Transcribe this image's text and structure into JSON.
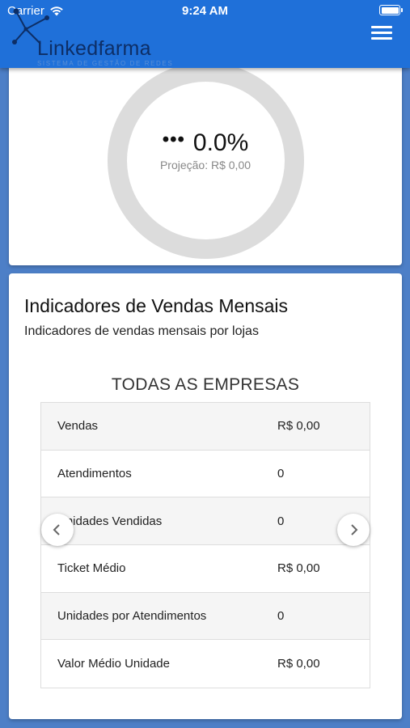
{
  "status_bar": {
    "carrier": "Carrier",
    "time": "9:24 AM"
  },
  "header": {
    "logo_text": "Linkedfarma",
    "logo_subtitle": "SISTEMA DE GESTÃO DE REDES",
    "menu_icon": "hamburger-menu-icon",
    "background_color": "#1f70d9"
  },
  "gauge": {
    "prefix": "•••",
    "value": "0.0%",
    "projection": "Projeção: R$ 0,00",
    "ring_color": "#dcdcdc"
  },
  "sales": {
    "title": "Indicadores de Vendas Mensais",
    "subtitle": "Indicadores de vendas mensais por lojas",
    "company": "TODAS AS EMPRESAS",
    "rows": [
      {
        "label": "Vendas",
        "value": "R$ 0,00"
      },
      {
        "label": "Atendimentos",
        "value": "0"
      },
      {
        "label": "Unidades Vendidas",
        "value": "0"
      },
      {
        "label": "Ticket Médio",
        "value": "R$ 0,00"
      },
      {
        "label": "Unidades por Atendimentos",
        "value": "0"
      },
      {
        "label": "Valor Médio Unidade",
        "value": "R$ 0,00"
      }
    ],
    "prev_icon": "chevron-left-icon",
    "next_icon": "chevron-right-icon"
  }
}
